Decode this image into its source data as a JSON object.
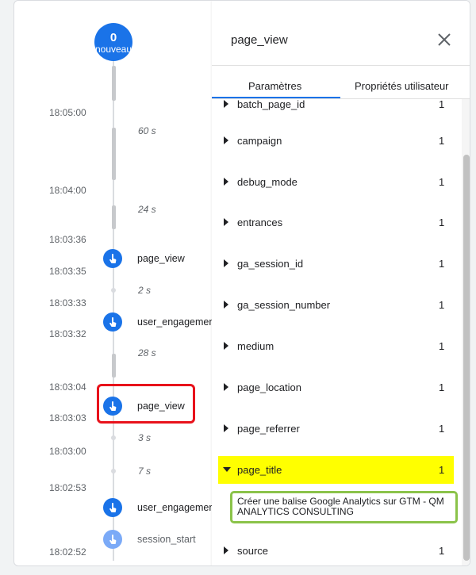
{
  "counter": {
    "value": "0",
    "label": "nouveau"
  },
  "timeline": {
    "times": [
      "18:05:00",
      "18:04:00",
      "18:03:36",
      "18:03:35",
      "18:03:33",
      "18:03:32",
      "18:03:04",
      "18:03:03",
      "18:03:00",
      "18:02:53",
      "18:02:52"
    ],
    "gaps": [
      "60 s",
      "24 s",
      "2 s",
      "28 s",
      "3 s",
      "7 s"
    ],
    "events": [
      "page_view",
      "user_engagement",
      "page_view",
      "user_engagement",
      "session_start"
    ]
  },
  "panel": {
    "title": "page_view",
    "tabs": [
      "Paramètres",
      "Propriétés utilisateur"
    ],
    "partial_row": "batch_page_id",
    "params": [
      {
        "name": "campaign",
        "count": "1"
      },
      {
        "name": "debug_mode",
        "count": "1"
      },
      {
        "name": "entrances",
        "count": "1"
      },
      {
        "name": "ga_session_id",
        "count": "1"
      },
      {
        "name": "ga_session_number",
        "count": "1"
      },
      {
        "name": "medium",
        "count": "1"
      },
      {
        "name": "page_location",
        "count": "1"
      },
      {
        "name": "page_referrer",
        "count": "1"
      },
      {
        "name": "page_title",
        "count": "1"
      },
      {
        "name": "source",
        "count": "1"
      }
    ],
    "partial_count": "1",
    "page_title_value": "Créer une balise Google Analytics sur GTM - QM ANALYTICS CONSULTING"
  },
  "colors": {
    "accent": "#1a73e8",
    "highlight": "#ffff00",
    "red_box": "#e8121b",
    "green_box": "#8bc34a"
  }
}
